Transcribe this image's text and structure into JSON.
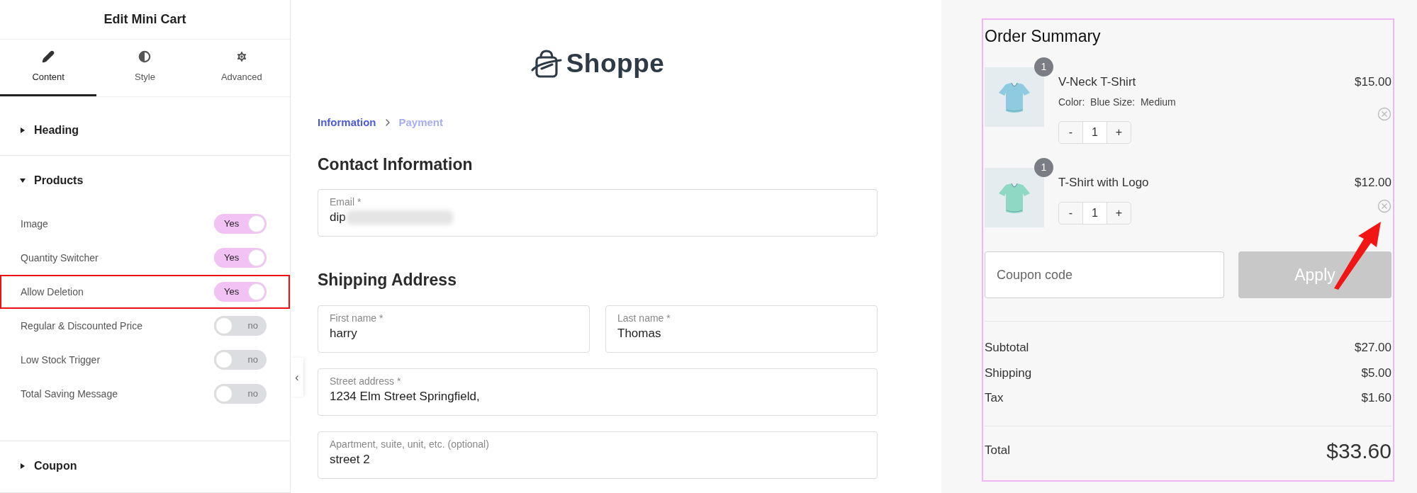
{
  "editor": {
    "title": "Edit Mini Cart",
    "tabs": [
      {
        "label": "Content",
        "selected": true
      },
      {
        "label": "Style",
        "selected": false
      },
      {
        "label": "Advanced",
        "selected": false
      }
    ],
    "sections": [
      {
        "title": "Heading",
        "expanded": false
      },
      {
        "title": "Products",
        "expanded": true,
        "toggles": [
          {
            "label": "Image",
            "on": true,
            "text": "Yes",
            "highlighted": false
          },
          {
            "label": "Quantity Switcher",
            "on": true,
            "text": "Yes",
            "highlighted": false
          },
          {
            "label": "Allow Deletion",
            "on": true,
            "text": "Yes",
            "highlighted": true
          },
          {
            "label": "Regular & Discounted Price",
            "on": false,
            "text": "no",
            "highlighted": false
          },
          {
            "label": "Low Stock Trigger",
            "on": false,
            "text": "no",
            "highlighted": false
          },
          {
            "label": "Total Saving Message",
            "on": false,
            "text": "no",
            "highlighted": false
          }
        ]
      },
      {
        "title": "Coupon",
        "expanded": false
      }
    ],
    "collapse_handle": "‹"
  },
  "checkout": {
    "logo": "Shoppe",
    "breadcrumb": [
      {
        "label": "Information",
        "selected": true
      },
      {
        "label": "Payment",
        "selected": false
      }
    ],
    "contact": {
      "title": "Contact Information",
      "email": {
        "label": "Email *",
        "value": "dip",
        "redacted": true
      }
    },
    "shipping": {
      "title": "Shipping Address",
      "first_name": {
        "label": "First name *",
        "value": "harry"
      },
      "last_name": {
        "label": "Last name *",
        "value": "Thomas"
      },
      "street": {
        "label": "Street address *",
        "value": "1234 Elm Street Springfield,"
      },
      "apartment": {
        "label": "Apartment, suite, unit, etc. (optional)",
        "value": "street 2"
      }
    }
  },
  "order_summary": {
    "title": "Order Summary",
    "items": [
      {
        "name": "V-Neck T-Shirt",
        "badge": "1",
        "variant": "Color:  Blue Size:  Medium",
        "price": "$15.00",
        "quantity": "1",
        "minus": "-",
        "plus": "+"
      },
      {
        "name": "T-Shirt with Logo",
        "badge": "1",
        "price": "$12.00",
        "quantity": "1",
        "minus": "-",
        "plus": "+"
      }
    ],
    "coupon": {
      "placeholder": "Coupon code",
      "button": "Apply",
      "disabled": true
    },
    "lines": [
      {
        "label": "Subtotal",
        "value": "$27.00"
      },
      {
        "label": "Shipping",
        "value": "$5.00"
      },
      {
        "label": "Tax",
        "value": "$1.60"
      }
    ],
    "total": {
      "label": "Total",
      "value": "$33.60"
    }
  }
}
